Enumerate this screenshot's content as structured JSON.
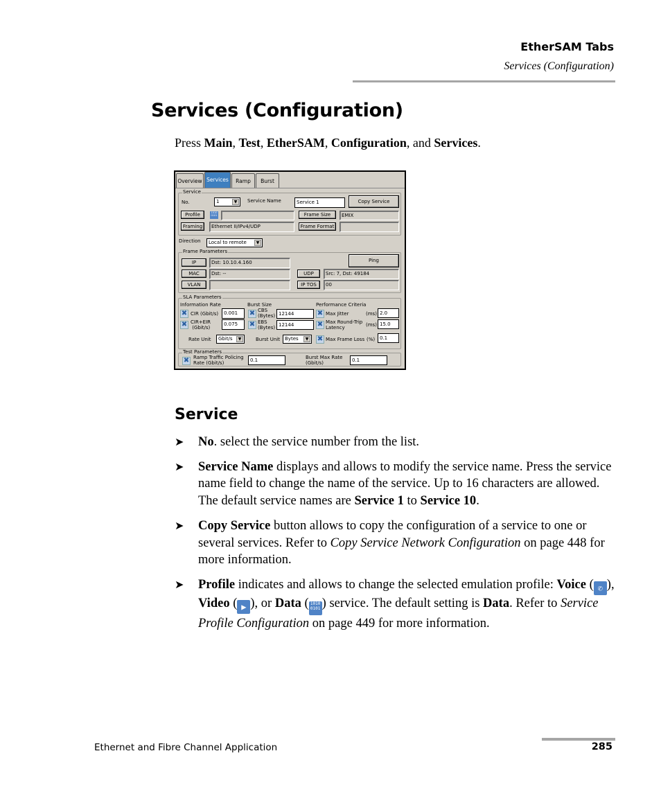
{
  "header": {
    "chapter": "EtherSAM Tabs",
    "section": "Services (Configuration)"
  },
  "page_title": "Services (Configuration)",
  "intro": {
    "prefix": "Press ",
    "steps": [
      "Main",
      "Test",
      "EtherSAM",
      "Configuration",
      "Services"
    ],
    "sep": ", ",
    "and": ", and ",
    "suffix": "."
  },
  "device": {
    "tabs": [
      {
        "label": "Overview",
        "active": false
      },
      {
        "label": "Services",
        "active": true
      },
      {
        "label": "Ramp",
        "active": false
      },
      {
        "label": "Burst",
        "active": false
      }
    ],
    "service_group": {
      "label": "Service",
      "no_label": "No.",
      "no_value": "1",
      "service_name_label": "Service Name",
      "service_name_value": "Service 1",
      "copy_service_button": "Copy Service",
      "profile_button": "Profile",
      "profile_icon": "data-icon",
      "profile_icon_text": "1010 0101",
      "profile_value": "",
      "frame_size_button": "Frame Size",
      "frame_size_value": "EMIX",
      "framing_button": "Framing",
      "framing_value": "Ethernet II/IPv4/UDP",
      "frame_format_button": "Frame Format",
      "frame_format_value": ""
    },
    "direction": {
      "label": "Direction",
      "value": "Local to remote"
    },
    "frame_parameters": {
      "label": "Frame Parameters",
      "ip_button": "IP",
      "ip_value": "Dst: 10.10.4.160",
      "ping_button": "Ping",
      "mac_button": "MAC",
      "mac_value": "Dst: --",
      "udp_button": "UDP",
      "udp_value": "Src: 7, Dst: 49184",
      "vlan_button": "VLAN",
      "vlan_value": "",
      "iptos_button": "IP TOS",
      "iptos_value": "00"
    },
    "sla_parameters": {
      "label": "SLA Parameters",
      "information_rate_label": "Information Rate",
      "cir_label": "CIR (Gbit/s)",
      "cir_value": "0.001",
      "cir_eir_label_1": "CIR+EIR",
      "cir_eir_label_2": "(Gbit/s)",
      "cir_eir_value": "0.075",
      "rate_unit_label": "Rate Unit",
      "rate_unit_value": "Gbit/s",
      "burst_size_label": "Burst Size",
      "cbs_label_1": "CBS",
      "cbs_label_2": "(Bytes)",
      "cbs_value": "12144",
      "ebs_label_1": "EBS",
      "ebs_label_2": "(Bytes)",
      "ebs_value": "12144",
      "burst_unit_label": "Burst Unit",
      "burst_unit_value": "Bytes",
      "performance_label": "Performance Criteria",
      "max_jitter_label": "Max Jitter",
      "max_jitter_unit": "(ms)",
      "max_jitter_value": "2.0",
      "max_rtl_label_1": "Max Round-Trip",
      "max_rtl_label_2": "Latency",
      "max_rtl_unit": "(ms)",
      "max_rtl_value": "15.0",
      "max_frame_loss_label": "Max Frame Loss",
      "max_frame_loss_unit": "(%)",
      "max_frame_loss_value": "0.1"
    },
    "test_parameters": {
      "label": "Test Parameters",
      "ramp_label_1": "Ramp Traffic Policing",
      "ramp_label_2": "Rate (Gbit/s)",
      "ramp_value": "0.1",
      "burst_max_label_1": "Burst Max Rate",
      "burst_max_label_2": "(Gbit/s)",
      "burst_max_value": "0.1"
    }
  },
  "section_heading": "Service",
  "bullets": {
    "b1": {
      "bold": "No",
      "text": ". select the service number from the list."
    },
    "b2": {
      "bold": "Service Name",
      "text1": " displays and allows to modify the service name. Press the service name field to change the name of the service. Up to 16 characters are allowed. The default service names are ",
      "bold2": "Service 1",
      "text2": " to ",
      "bold3": "Service 10",
      "text3": "."
    },
    "b3": {
      "bold": "Copy Service",
      "text1": " button allows to copy the configuration of a service to one or several services. Refer to ",
      "italic": "Copy Service Network Configuration",
      "text2": " on page 448 for more information."
    },
    "b4": {
      "bold": "Profile",
      "text1": " indicates and allows to change the selected emulation profile: ",
      "voice": "Voice",
      "open": " (",
      "close_comma": "), ",
      "video": "Video",
      "close_or": "), or ",
      "data": "Data",
      "text2": ") service. The default setting is ",
      "data2": "Data",
      "text3": ". Refer to ",
      "italic": "Service Profile Configuration",
      "text4": " on page 449 for more information.",
      "voice_icon_glyph": "✆",
      "video_icon_glyph": "▶",
      "data_icon_text": "1010 0101"
    }
  },
  "footer": {
    "left": "Ethernet and Fibre Channel Application",
    "page_number": "285"
  }
}
